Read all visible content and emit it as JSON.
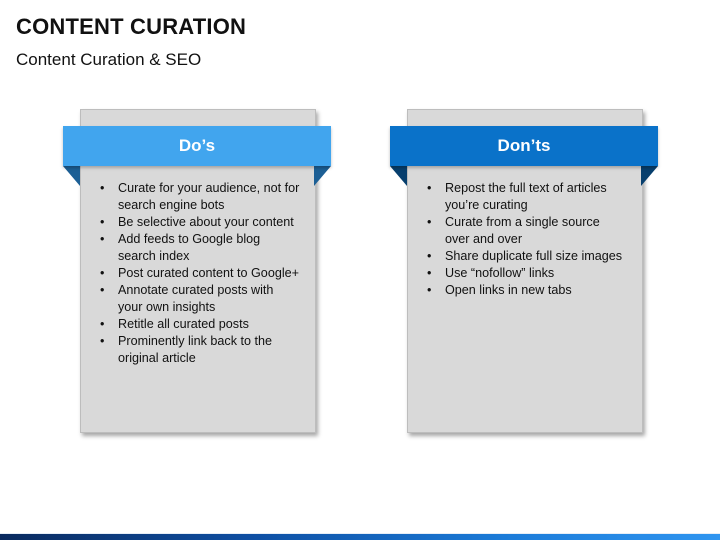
{
  "slide": {
    "title": "CONTENT CURATION",
    "subtitle": "Content Curation & SEO"
  },
  "colors": {
    "dos_banner": "#41a5ee",
    "donts_banner": "#0a72c9",
    "panel_fill": "#d9d9d9"
  },
  "dos": {
    "heading": "Do’s",
    "items": [
      "Curate for your audience, not for search engine bots",
      "Be selective about your content",
      "Add feeds to Google blog search index",
      "Post curated content to Google+",
      "Annotate curated posts with your own insights",
      "Retitle all curated posts",
      "Prominently link back to the original article"
    ]
  },
  "donts": {
    "heading": "Don’ts",
    "items": [
      "Repost the full text of articles you’re curating",
      "Curate from a single source over and over",
      "Share duplicate full size images",
      "Use “nofollow” links",
      "Open links in new tabs"
    ]
  }
}
